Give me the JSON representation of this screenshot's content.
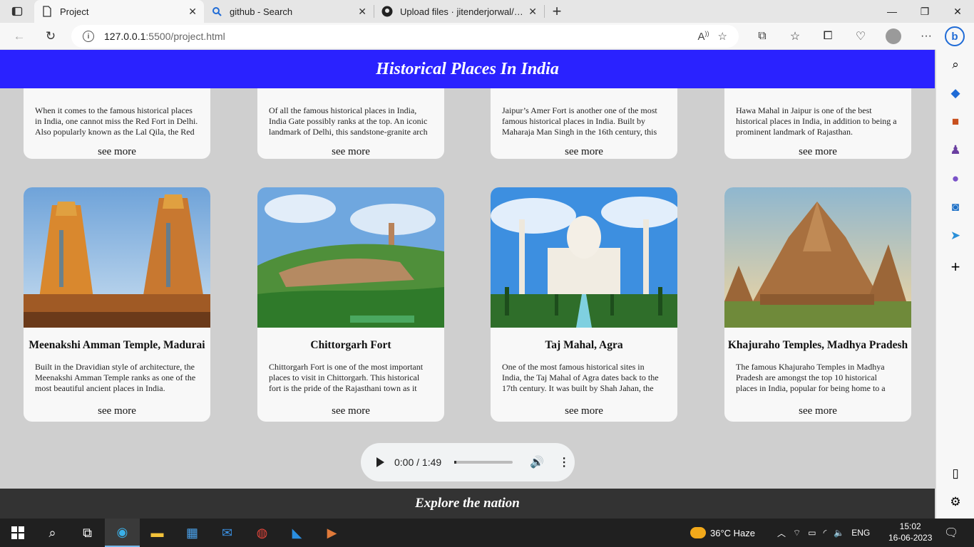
{
  "browser": {
    "tabs": [
      {
        "title": "Project",
        "icon": "page-icon"
      },
      {
        "title": "github - Search",
        "icon": "search-icon"
      },
      {
        "title": "Upload files · jitenderjorwal/proje",
        "icon": "github-icon"
      }
    ],
    "url_host": "127.0.0.1",
    "url_path": ":5500/project.html"
  },
  "site": {
    "header_title": "Historical Places In India",
    "footer_text": "Explore the nation",
    "top_cards": [
      {
        "text": "When it comes to the famous historical places in India, one cannot miss the Red Fort in Delhi. Also popularly known as the Lal Qila, the Red",
        "more": "see more"
      },
      {
        "text": "Of all the famous historical places in India, India Gate possibly ranks at the top. An iconic landmark of Delhi, this sandstone-granite arch",
        "more": "see more"
      },
      {
        "text": "Jaipur’s Amer Fort is another one of the most famous historical places in India. Built by Maharaja Man Singh in the 16th century, this",
        "more": "see more"
      },
      {
        "text": "Hawa Mahal in Jaipur is one of the best historical places in India, in addition to being a prominent landmark of Rajasthan.",
        "more": "see more"
      }
    ],
    "cards": [
      {
        "title": "Meenakshi Amman Temple, Madurai",
        "text": "Built in the Dravidian style of architecture, the Meenakshi Amman Temple ranks as one of the most beautiful ancient places in India.",
        "more": "see more"
      },
      {
        "title": "Chittorgarh Fort",
        "text": "Chittorgarh Fort is one of the most important places to visit in Chittorgarh. This historical fort is the pride of the Rajasthani town as it",
        "more": "see more"
      },
      {
        "title": "Taj Mahal, Agra",
        "text": "One of the most famous historical sites in India, the Taj Mahal of Agra dates back to the 17th century. It was built by Shah Jahan, the",
        "more": "see more"
      },
      {
        "title": "Khajuraho Temples, Madhya Pradesh",
        "text": "The famous Khajuraho Temples in Madhya Pradesh are amongst the top 10 historical places in India, popular for being home to a",
        "more": "see more"
      }
    ],
    "audio": {
      "time": "0:00 / 1:49"
    }
  },
  "taskbar": {
    "weather": "36°C  Haze",
    "lang": "ENG",
    "time": "15:02",
    "date": "16-06-2023"
  }
}
